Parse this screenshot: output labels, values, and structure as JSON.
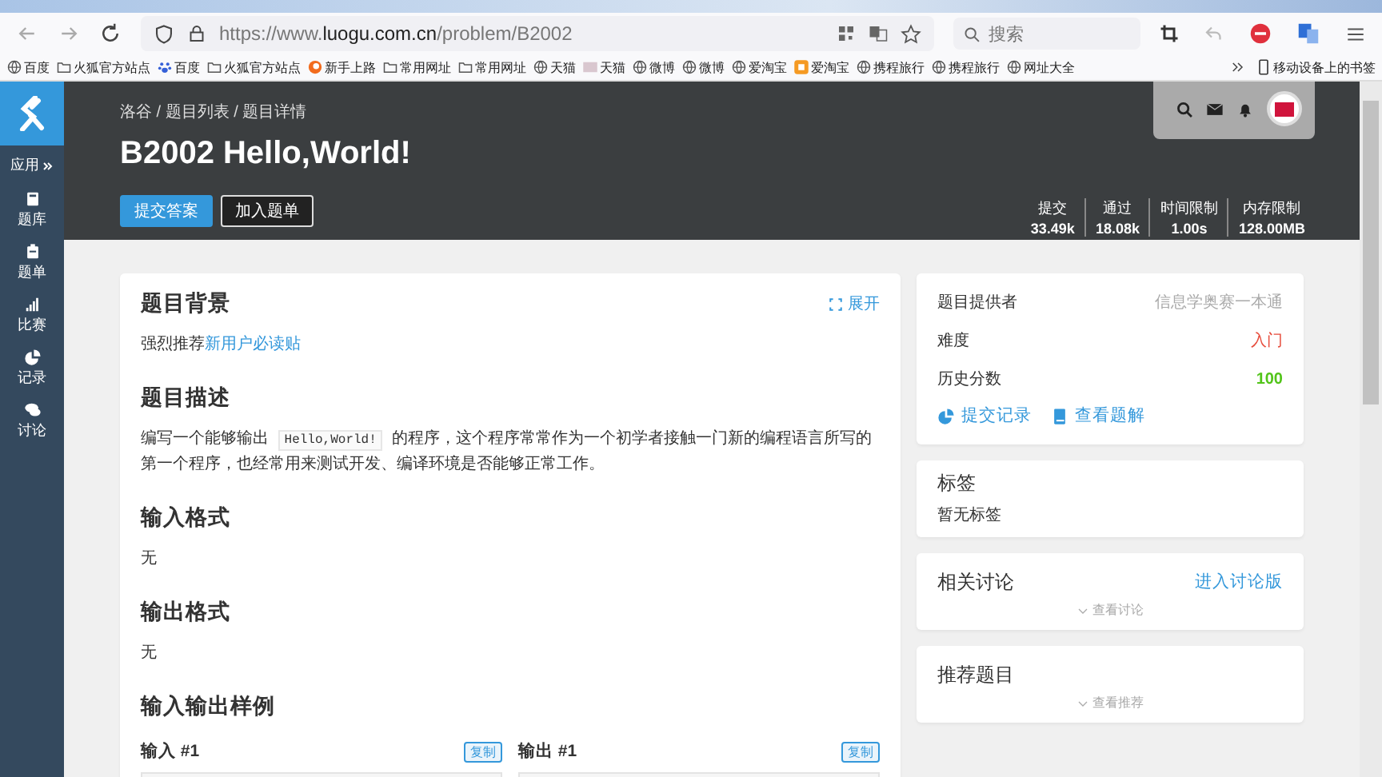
{
  "browser": {
    "url_host": "https://www.luogu.com.cn",
    "url_path": "/problem/B2002",
    "search_placeholder": "搜索",
    "bookmarks": [
      {
        "label": "百度",
        "kind": "globe"
      },
      {
        "label": "火狐官方站点",
        "kind": "folder"
      },
      {
        "label": "百度",
        "kind": "paw"
      },
      {
        "label": "火狐官方站点",
        "kind": "folder"
      },
      {
        "label": "新手上路",
        "kind": "fire"
      },
      {
        "label": "常用网址",
        "kind": "folder"
      },
      {
        "label": "常用网址",
        "kind": "folder"
      },
      {
        "label": "天猫",
        "kind": "globe"
      },
      {
        "label": "天猫",
        "kind": "image"
      },
      {
        "label": "微博",
        "kind": "globe"
      },
      {
        "label": "微博",
        "kind": "globe"
      },
      {
        "label": "爱淘宝",
        "kind": "globe"
      },
      {
        "label": "爱淘宝",
        "kind": "app"
      },
      {
        "label": "携程旅行",
        "kind": "globe"
      },
      {
        "label": "携程旅行",
        "kind": "globe"
      },
      {
        "label": "网址大全",
        "kind": "globe"
      }
    ],
    "mobile_bookmarks": "移动设备上的书签"
  },
  "sidebar": {
    "apps_label": "应用",
    "items": [
      {
        "label": "题库",
        "kind": "book"
      },
      {
        "label": "题单",
        "kind": "clipboard"
      },
      {
        "label": "比赛",
        "kind": "bars"
      },
      {
        "label": "记录",
        "kind": "pie"
      },
      {
        "label": "讨论",
        "kind": "chat"
      }
    ]
  },
  "header": {
    "breadcrumb": "洛谷 / 题目列表 / 题目详情",
    "title": "B2002 Hello,World!",
    "buttons": [
      {
        "label": "提交答案",
        "kind": "primary"
      },
      {
        "label": "加入题单",
        "kind": "outline"
      }
    ],
    "stats": [
      {
        "label": "提交",
        "value": "33.49k"
      },
      {
        "label": "通过",
        "value": "18.08k"
      },
      {
        "label": "时间限制",
        "value": "1.00s"
      },
      {
        "label": "内存限制",
        "value": "128.00MB"
      }
    ]
  },
  "problem": {
    "expand": "展开",
    "sections": [
      {
        "heading": "题目背景",
        "parts": [
          {
            "kind": "text",
            "text": "强烈推荐"
          },
          {
            "kind": "link",
            "text": "新用户必读贴"
          }
        ]
      },
      {
        "heading": "题目描述",
        "parts": [
          {
            "kind": "text",
            "text": "编写一个能够输出 "
          },
          {
            "kind": "code",
            "text": "Hello,World!"
          },
          {
            "kind": "text",
            "text": " 的程序，这个程序常常作为一个初学者接触一门新的编程语言所写的第一个程序，也经常用来测试开发、编译环境是否能够正常工作。"
          }
        ]
      },
      {
        "heading": "输入格式",
        "parts": [
          {
            "kind": "text",
            "text": "无"
          }
        ]
      },
      {
        "heading": "输出格式",
        "parts": [
          {
            "kind": "text",
            "text": "无"
          }
        ]
      }
    ],
    "samples_heading": "输入输出样例",
    "samples": [
      {
        "title": "输入 #1",
        "copy": "复制"
      },
      {
        "title": "输出 #1",
        "copy": "复制"
      }
    ]
  },
  "info": {
    "rows": [
      {
        "label": "题目提供者",
        "value": "信息学奥赛一本通",
        "color": "#aaaaaa"
      },
      {
        "label": "难度",
        "value": "入门",
        "color": "#e74c3c"
      },
      {
        "label": "历史分数",
        "value": "100",
        "color": "#52c41a"
      }
    ],
    "links": [
      {
        "label": "提交记录",
        "kind": "pie"
      },
      {
        "label": "查看题解",
        "kind": "book"
      }
    ]
  },
  "tags": {
    "title": "标签",
    "text": "暂无标签"
  },
  "discussion": {
    "title": "相关讨论",
    "link": "进入讨论版",
    "more": "查看讨论"
  },
  "recommended": {
    "title": "推荐题目",
    "more": "查看推荐"
  }
}
